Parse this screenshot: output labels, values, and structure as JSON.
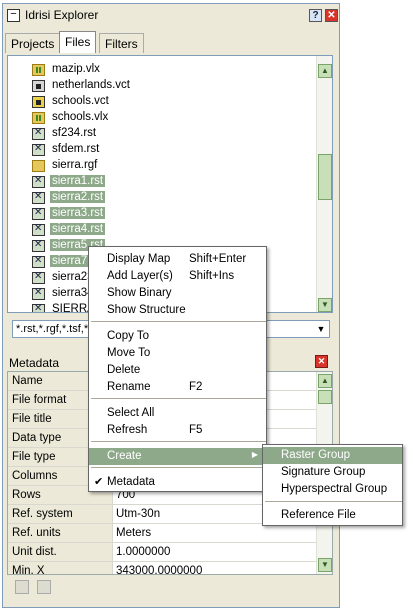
{
  "window": {
    "title": "Idrisi Explorer",
    "help_label": "?",
    "close_label": "✕"
  },
  "tabs": [
    {
      "label": "Projects"
    },
    {
      "label": "Files"
    },
    {
      "label": "Filters"
    }
  ],
  "files": [
    {
      "name": "mazip.vlx",
      "icon": "vlx-file-icon"
    },
    {
      "name": "netherlands.vct",
      "icon": "vector-file-icon"
    },
    {
      "name": "schools.vct",
      "icon": "vector-file-icon"
    },
    {
      "name": "schools.vlx",
      "icon": "vlx-file-icon"
    },
    {
      "name": "sf234.rst",
      "icon": "raster-file-icon"
    },
    {
      "name": "sfdem.rst",
      "icon": "raster-file-icon"
    },
    {
      "name": "sierra.rgf",
      "icon": "raster-group-file-icon"
    },
    {
      "name": "sierra1.rst",
      "icon": "raster-file-icon",
      "selected": true
    },
    {
      "name": "sierra2.rst",
      "icon": "raster-file-icon",
      "selected": true
    },
    {
      "name": "sierra3.rst",
      "icon": "raster-file-icon",
      "selected": true
    },
    {
      "name": "sierra4.rst",
      "icon": "raster-file-icon",
      "selected": true
    },
    {
      "name": "sierra5.rst",
      "icon": "raster-file-icon",
      "selected": true
    },
    {
      "name": "sierra7.rst",
      "icon": "raster-file-icon",
      "selected": true
    },
    {
      "name": "sierra23",
      "icon": "raster-file-icon"
    },
    {
      "name": "sierra34",
      "icon": "raster-file-icon"
    },
    {
      "name": "SIERRA",
      "icon": "raster-file-icon"
    }
  ],
  "filter": {
    "value": "*.rst,*.rgf,*.tsf,*."
  },
  "metadata": {
    "title": "Metadata",
    "rows": [
      {
        "key": "Name",
        "value": ""
      },
      {
        "key": "File format",
        "value": ""
      },
      {
        "key": "File title",
        "value": ""
      },
      {
        "key": "Data type",
        "value": ""
      },
      {
        "key": "File type",
        "value": ""
      },
      {
        "key": "Columns",
        "value": ""
      },
      {
        "key": "Rows",
        "value": "700"
      },
      {
        "key": "Ref. system",
        "value": "Utm-30n"
      },
      {
        "key": "Ref. units",
        "value": "Meters"
      },
      {
        "key": "Unit dist.",
        "value": "1.0000000"
      },
      {
        "key": "Min. X",
        "value": "343000.0000000"
      }
    ]
  },
  "context_menu": {
    "items": [
      {
        "label": "Display Map",
        "shortcut": "Shift+Enter"
      },
      {
        "label": "Add Layer(s)",
        "shortcut": "Shift+Ins"
      },
      {
        "label": "Show Binary",
        "shortcut": ""
      },
      {
        "label": "Show Structure",
        "shortcut": ""
      },
      {
        "label": "Copy To",
        "shortcut": ""
      },
      {
        "label": "Move To",
        "shortcut": ""
      },
      {
        "label": "Delete",
        "shortcut": ""
      },
      {
        "label": "Rename",
        "shortcut": "F2"
      },
      {
        "label": "Select All",
        "shortcut": ""
      },
      {
        "label": "Refresh",
        "shortcut": "F5"
      },
      {
        "label": "Create",
        "shortcut": "",
        "submenu": true,
        "highlighted": true
      },
      {
        "label": "Metadata",
        "shortcut": "",
        "checked": true
      }
    ]
  },
  "create_submenu": {
    "items": [
      {
        "label": "Raster Group",
        "highlighted": true
      },
      {
        "label": "Signature Group"
      },
      {
        "label": "Hyperspectral Group"
      },
      {
        "label": "Reference File"
      }
    ]
  },
  "colors": {
    "selection": "#8da98a",
    "window_bg": "#ece9d8",
    "close_red": "#d9342b"
  }
}
